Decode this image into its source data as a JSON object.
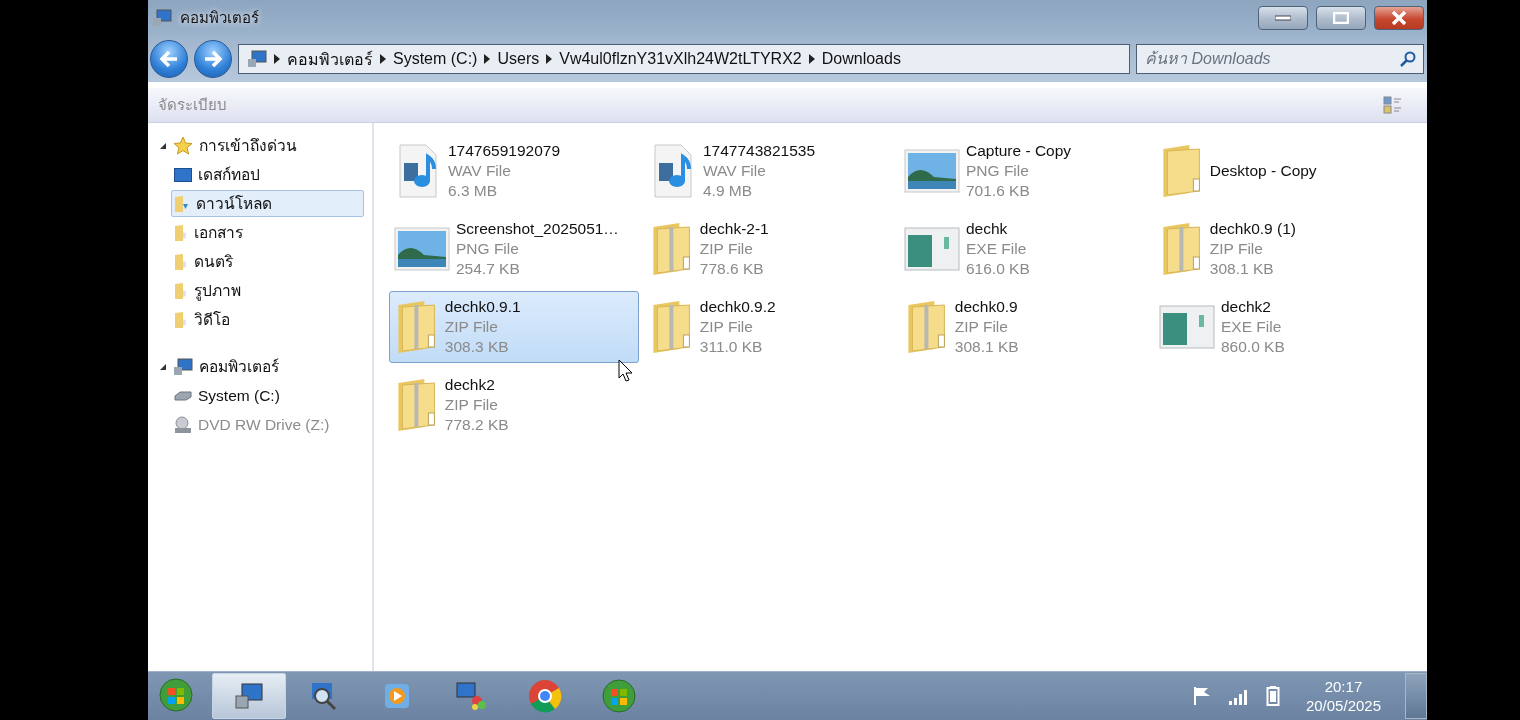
{
  "window": {
    "title": "คอมพิวเตอร์"
  },
  "address": {
    "segments": [
      "คอมพิวเตอร์",
      "System (C:)",
      "Users",
      "Vw4ul0flznY31vXlh24W2tLTYRX2",
      "Downloads"
    ]
  },
  "search": {
    "placeholder": "ค้นหา Downloads"
  },
  "toolbar": {
    "organize": "จัดระเบียบ"
  },
  "sidebar": [
    {
      "label": "การเข้าถึงด่วน",
      "kind": "star",
      "expanded": true,
      "selected": false,
      "children": [
        {
          "label": "เดสก์ทอป",
          "kind": "desktop",
          "selected": false,
          "disabled": false
        },
        {
          "label": "ดาวน์โหลด",
          "kind": "downloads",
          "selected": true,
          "disabled": false
        },
        {
          "label": "เอกสาร",
          "kind": "folder",
          "selected": false,
          "disabled": false
        },
        {
          "label": "ดนตริ",
          "kind": "folder",
          "selected": false,
          "disabled": false
        },
        {
          "label": "รูปภาพ",
          "kind": "folder",
          "selected": false,
          "disabled": false
        },
        {
          "label": "วิดีโอ",
          "kind": "folder",
          "selected": false,
          "disabled": false
        }
      ]
    },
    {
      "label": "คอมพิวเตอร์",
      "kind": "computer",
      "expanded": true,
      "selected": false,
      "children": [
        {
          "label": "System (C:)",
          "kind": "drive",
          "selected": false,
          "disabled": false
        },
        {
          "label": "DVD RW Drive (Z:)",
          "kind": "dvd",
          "selected": false,
          "disabled": true
        }
      ]
    }
  ],
  "files": [
    {
      "name": "1747659192079",
      "type": "WAV File",
      "size": "6.3 MB",
      "kind": "audio",
      "selected": false
    },
    {
      "name": "1747743821535",
      "type": "WAV File",
      "size": "4.9 MB",
      "kind": "audio",
      "selected": false
    },
    {
      "name": "Capture - Copy",
      "type": "PNG File",
      "size": "701.6 KB",
      "kind": "image",
      "selected": false
    },
    {
      "name": "Desktop - Copy",
      "kind": "folder",
      "selected": false
    },
    {
      "name": "Screenshot_2025051…",
      "type": "PNG File",
      "size": "254.7 KB",
      "kind": "image",
      "selected": false
    },
    {
      "name": "dechk-2-1",
      "type": "ZIP File",
      "size": "778.6 KB",
      "kind": "zip",
      "selected": false
    },
    {
      "name": "dechk",
      "type": "EXE File",
      "size": "616.0 KB",
      "kind": "exe",
      "selected": false
    },
    {
      "name": "dechk0.9 (1)",
      "type": "ZIP File",
      "size": "308.1 KB",
      "kind": "zip",
      "selected": false
    },
    {
      "name": "dechk0.9.1",
      "type": "ZIP File",
      "size": "308.3 KB",
      "kind": "zip",
      "selected": true
    },
    {
      "name": "dechk0.9.2",
      "type": "ZIP File",
      "size": "311.0 KB",
      "kind": "zip",
      "selected": false
    },
    {
      "name": "dechk0.9",
      "type": "ZIP File",
      "size": "308.1 KB",
      "kind": "zip",
      "selected": false
    },
    {
      "name": "dechk2",
      "type": "EXE File",
      "size": "860.0 KB",
      "kind": "exe",
      "selected": false
    },
    {
      "name": "dechk2",
      "type": "ZIP File",
      "size": "778.2 KB",
      "kind": "zip",
      "selected": false
    }
  ],
  "taskbar": {
    "items": [
      {
        "kind": "explorer",
        "selected": true
      },
      {
        "kind": "search",
        "selected": false
      },
      {
        "kind": "media",
        "selected": false
      },
      {
        "kind": "paint",
        "selected": false
      },
      {
        "kind": "browser",
        "selected": false
      },
      {
        "kind": "orb",
        "selected": false
      }
    ],
    "time": "20:17",
    "date": "20/05/2025"
  }
}
